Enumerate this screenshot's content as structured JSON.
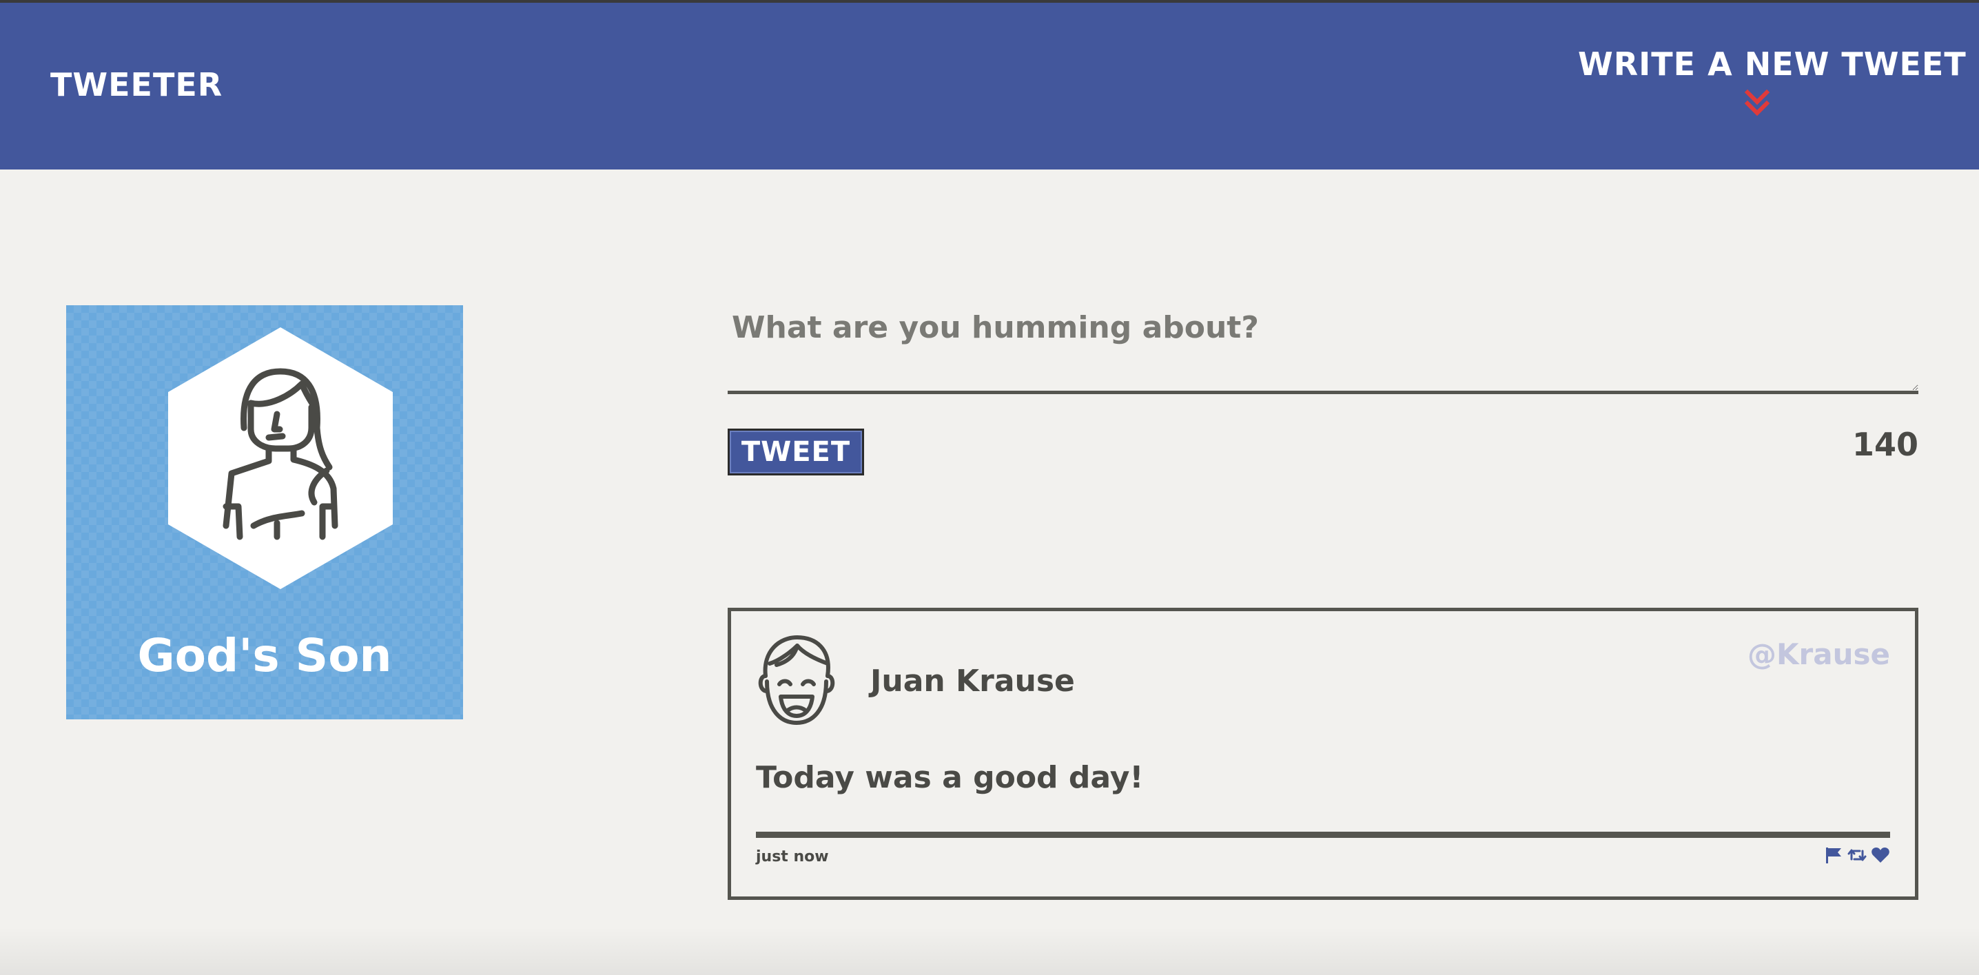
{
  "header": {
    "brand": "TWEETER",
    "compose_toggle_label": "WRITE A NEW TWEET",
    "compose_toggle_icon": "double-chevron-down-icon",
    "background_color": "#43579c",
    "accent_color": "#e03a3a"
  },
  "profile": {
    "name": "God's Son",
    "avatar_icon": "woman-avatar-icon",
    "background_color": "#6aa9dd"
  },
  "composer": {
    "placeholder": "What are you humming about?",
    "value": "",
    "submit_label": "TWEET",
    "char_counter": "140"
  },
  "tweets": [
    {
      "avatar_icon": "smiling-man-avatar-icon",
      "name": "Juan Krause",
      "handle": "@Krause",
      "text": "Today was a good day!",
      "timestamp": "just now",
      "actions": [
        {
          "icon": "flag-icon"
        },
        {
          "icon": "retweet-icon"
        },
        {
          "icon": "heart-icon"
        }
      ]
    }
  ]
}
